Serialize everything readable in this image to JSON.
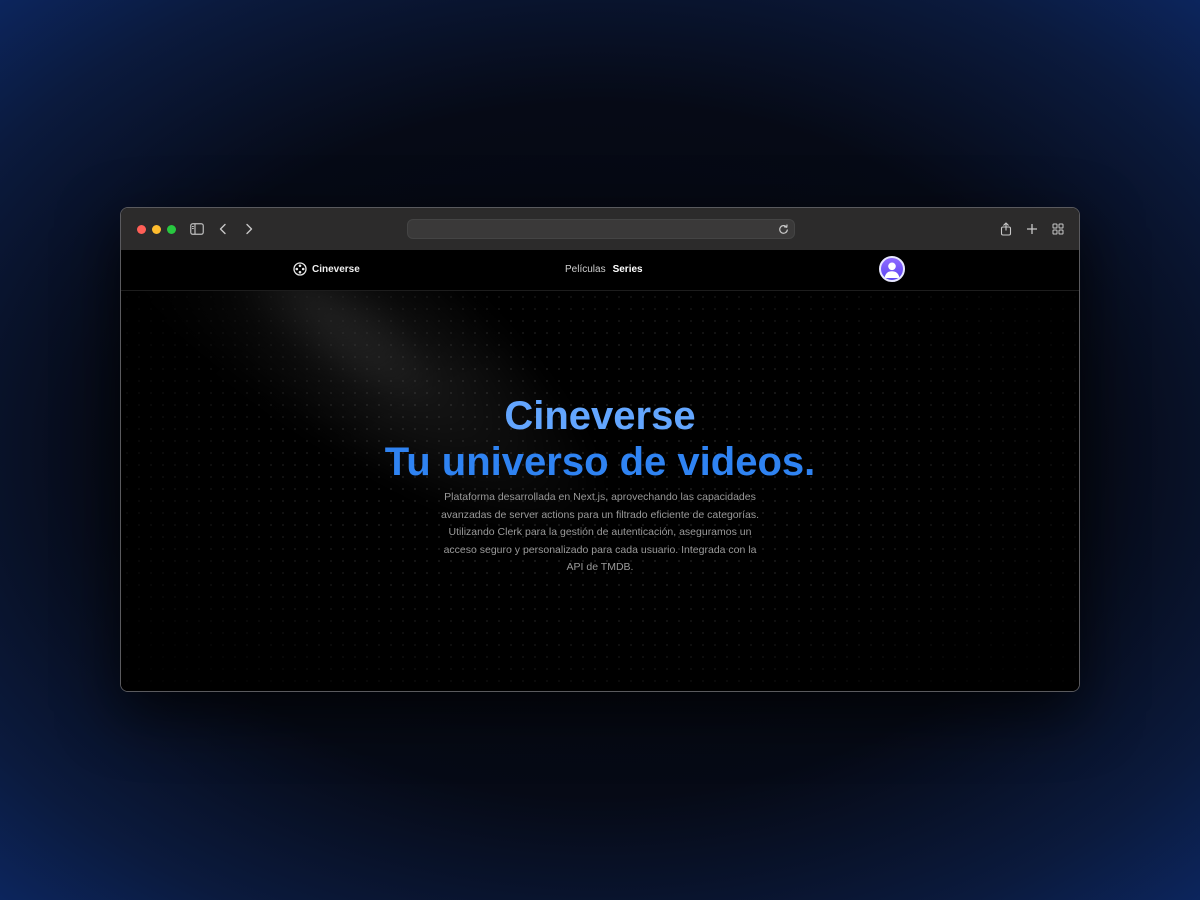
{
  "browser": {
    "url_value": "",
    "icons": {
      "sidebar": "sidebar-icon",
      "back": "chevron-left-icon",
      "forward": "chevron-right-icon",
      "reload": "reload-icon",
      "share": "share-icon",
      "new_tab": "plus-icon",
      "tabs": "grid-icon"
    }
  },
  "navbar": {
    "brand": "Cineverse",
    "brand_icon": "film-reel-icon",
    "links": [
      "Películas",
      "Series"
    ],
    "avatar_icon": "user-icon"
  },
  "hero": {
    "title_line1": "Cineverse",
    "title_line2": "Tu universo de videos.",
    "description": "Plataforma desarrollada en Next.js, aprovechando las capacidades avanzadas de server actions para un filtrado eficiente de categorías. Utilizando Clerk para la gestión de autenticación, aseguramos un acceso seguro y personalizado para cada usuario. Integrada con la API de TMDB."
  },
  "colors": {
    "title_light_blue": "#63a6ff",
    "title_blue": "#2f83f2",
    "avatar_purple": "#6b52f5"
  }
}
